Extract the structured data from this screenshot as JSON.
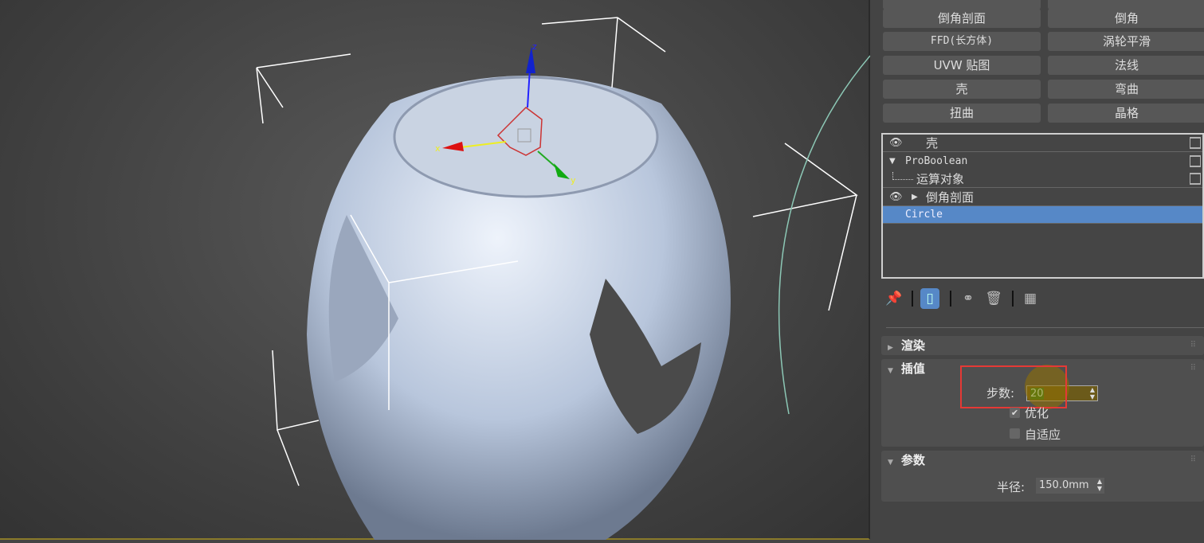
{
  "modifier_buttons": [
    {
      "label": "倒角剖面"
    },
    {
      "label": "倒角"
    },
    {
      "label": "FFD(长方体)"
    },
    {
      "label": "涡轮平滑"
    },
    {
      "label": "UVW 贴图"
    },
    {
      "label": "法线"
    },
    {
      "label": "壳"
    },
    {
      "label": "弯曲"
    },
    {
      "label": "扭曲"
    },
    {
      "label": "晶格"
    }
  ],
  "stack": {
    "items": [
      {
        "label": "壳",
        "icon": "eye-icon"
      },
      {
        "label": "ProBoolean",
        "icon": "triangle-down-icon"
      },
      {
        "label": "运算对象"
      },
      {
        "label": "倒角剖面",
        "icon": "eye-icon"
      },
      {
        "label": "Circle",
        "selected": true
      }
    ]
  },
  "toolbar": {
    "icons": [
      "pin-stack-icon",
      "show-end-result-icon",
      "make-unique-icon",
      "remove-modifier-icon",
      "configure-modifier-sets-icon"
    ]
  },
  "rollouts": {
    "render": {
      "title": "渲染",
      "collapsed": true
    },
    "interp": {
      "title": "插值",
      "steps_label": "步数:",
      "steps_value": "20",
      "optimize_label": "优化",
      "optimize_checked": true,
      "adaptive_label": "自适应",
      "adaptive_checked": false
    },
    "params": {
      "title": "参数",
      "radius_label": "半径:",
      "radius_value": "150.0mm"
    }
  },
  "gizmo": {
    "x": "x",
    "y": "y",
    "z": "z"
  },
  "colors": {
    "selection": "#5688c7",
    "highlight_box": "#e53935",
    "object": "#c8d4e8"
  }
}
